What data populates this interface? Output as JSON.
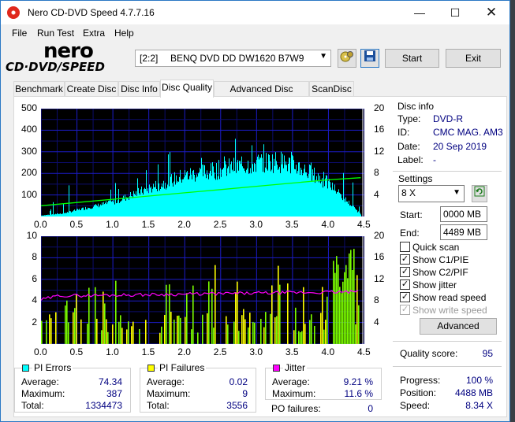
{
  "window": {
    "title": "Nero CD-DVD Speed 4.7.7.16"
  },
  "menu": [
    "File",
    "Run Test",
    "Extra",
    "Help"
  ],
  "logo": {
    "line1": "nero",
    "line2": "CD·DVD/SPEED"
  },
  "drive": {
    "label": "[2:2]",
    "name": "BENQ DVD DD DW1620 B7W9"
  },
  "buttons": {
    "start": "Start",
    "exit": "Exit",
    "advanced": "Advanced"
  },
  "tabs": [
    "Benchmark",
    "Create Disc",
    "Disc Info",
    "Disc Quality",
    "Advanced Disc Quality",
    "ScanDisc"
  ],
  "active_tab": "Disc Quality",
  "disc_info": {
    "title": "Disc info",
    "type_label": "Type:",
    "type": "DVD-R",
    "id_label": "ID:",
    "id": "CMC MAG. AM3",
    "date_label": "Date:",
    "date": "20 Sep 2019",
    "label_label": "Label:",
    "label": "-"
  },
  "settings": {
    "title": "Settings",
    "speed": "8 X",
    "start_label": "Start:",
    "start": "0000 MB",
    "end_label": "End:",
    "end": "4489 MB",
    "checks": [
      {
        "label": "Quick scan",
        "checked": false,
        "enabled": true
      },
      {
        "label": "Show C1/PIE",
        "checked": true,
        "enabled": true
      },
      {
        "label": "Show C2/PIF",
        "checked": true,
        "enabled": true
      },
      {
        "label": "Show jitter",
        "checked": true,
        "enabled": true
      },
      {
        "label": "Show read speed",
        "checked": true,
        "enabled": true
      },
      {
        "label": "Show write speed",
        "checked": true,
        "enabled": false
      }
    ]
  },
  "quality": {
    "label": "Quality score:",
    "value": "95"
  },
  "progress": {
    "progress_label": "Progress:",
    "progress": "100 %",
    "position_label": "Position:",
    "position": "4488 MB",
    "speed_label": "Speed:",
    "speed": "8.34 X"
  },
  "pi_errors": {
    "title": "PI Errors",
    "avg_label": "Average:",
    "avg": "74.34",
    "max_label": "Maximum:",
    "max": "387",
    "total_label": "Total:",
    "total": "1334473",
    "color": "#00ffff"
  },
  "pi_failures": {
    "title": "PI Failures",
    "avg_label": "Average:",
    "avg": "0.02",
    "max_label": "Maximum:",
    "max": "9",
    "total_label": "Total:",
    "total": "3556",
    "color": "#ffff00"
  },
  "jitter": {
    "title": "Jitter",
    "avg_label": "Average:",
    "avg": "9.21 %",
    "max_label": "Maximum:",
    "max": "11.6 %",
    "po_label": "PO failures:",
    "po": "0",
    "color": "#ff00ff"
  },
  "chart_data": [
    {
      "type": "area",
      "x_ticks": [
        "0.0",
        "0.5",
        "1.0",
        "1.5",
        "2.0",
        "2.5",
        "3.0",
        "3.5",
        "4.0",
        "4.5"
      ],
      "y_left_ticks": [
        "100",
        "200",
        "300",
        "400",
        "500"
      ],
      "y_right_ticks": [
        "4",
        "8",
        "12",
        "16",
        "20"
      ],
      "xlim": [
        0,
        4.5
      ],
      "ylim_left": [
        0,
        500
      ],
      "ylim_right": [
        0,
        20
      ],
      "series": [
        {
          "values_envelope": [
            [
              0.0,
              5
            ],
            [
              0.3,
              15
            ],
            [
              0.6,
              40
            ],
            [
              1.0,
              70
            ],
            [
              1.3,
              110
            ],
            [
              1.6,
              150
            ],
            [
              2.0,
              200
            ],
            [
              2.5,
              230
            ],
            [
              3.0,
              260
            ],
            [
              3.3,
              270
            ],
            [
              3.6,
              240
            ],
            [
              4.0,
              160
            ],
            [
              4.3,
              60
            ],
            [
              4.45,
              10
            ]
          ],
          "color": "#00ffff"
        },
        {
          "values_speed": [
            [
              0.0,
              2.0
            ],
            [
              0.5,
              2.6
            ],
            [
              1.0,
              3.2
            ],
            [
              1.5,
              3.8
            ],
            [
              2.0,
              4.4
            ],
            [
              2.5,
              5.0
            ],
            [
              3.0,
              5.6
            ],
            [
              3.5,
              6.2
            ],
            [
              4.0,
              6.8
            ],
            [
              4.45,
              7.2
            ]
          ],
          "color": "#00ff00"
        }
      ],
      "grid": true
    },
    {
      "type": "bar",
      "x_ticks": [
        "0.0",
        "0.5",
        "1.0",
        "1.5",
        "2.0",
        "2.5",
        "3.0",
        "3.5",
        "4.0",
        "4.5"
      ],
      "y_left_ticks": [
        "2",
        "4",
        "6",
        "8",
        "10"
      ],
      "y_right_ticks": [
        "4",
        "8",
        "12",
        "16",
        "20"
      ],
      "xlim": [
        0,
        4.5
      ],
      "ylim_left": [
        0,
        10
      ],
      "ylim_right": [
        0,
        20
      ],
      "grid": true
    }
  ]
}
